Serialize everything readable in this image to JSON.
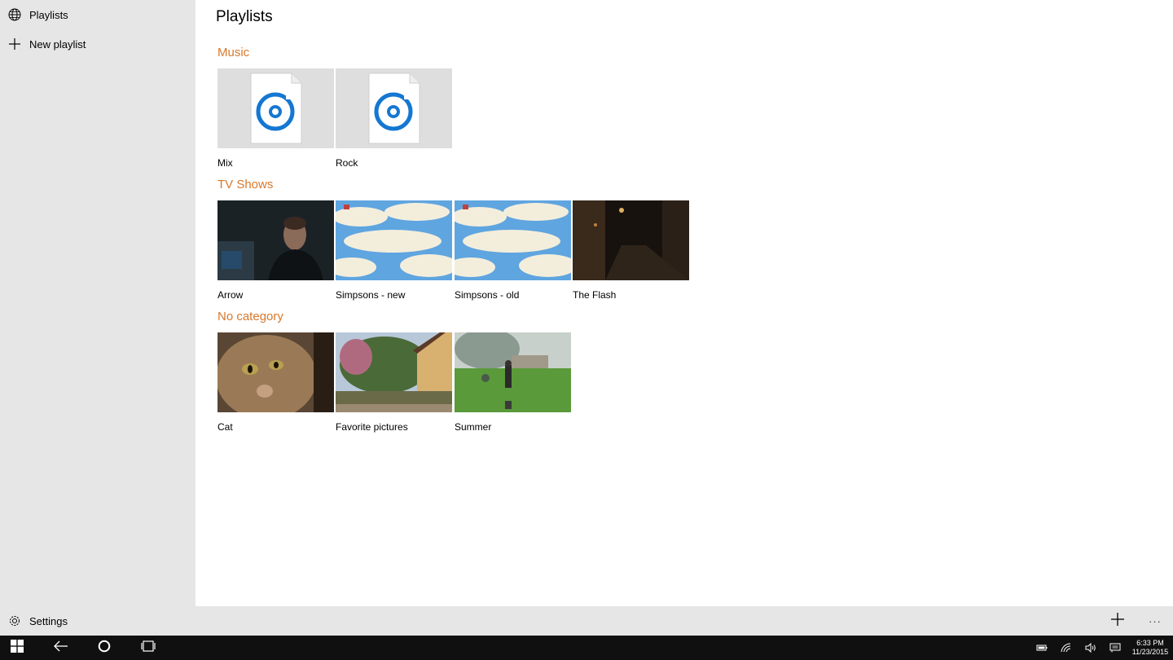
{
  "sidebar": {
    "items": [
      {
        "label": "Playlists",
        "icon": "globe-icon"
      },
      {
        "label": "New playlist",
        "icon": "plus-icon"
      }
    ],
    "settings_label": "Settings"
  },
  "main": {
    "title": "Playlists",
    "sections": [
      {
        "title": "Music",
        "items": [
          "Mix",
          "Rock"
        ]
      },
      {
        "title": "TV Shows",
        "items": [
          "Arrow",
          "Simpsons - new",
          "Simpsons - old",
          "The Flash"
        ]
      },
      {
        "title": "No category",
        "items": [
          "Cat",
          "Favorite pictures",
          "Summer"
        ]
      }
    ]
  },
  "appbar": {
    "more_label": "···"
  },
  "taskbar": {
    "time": "6:33 PM",
    "date": "11/23/2015"
  },
  "colors": {
    "accent": "#d9782b",
    "music_icon": "#1477d2",
    "sidebar_bg": "#e6e6e6",
    "taskbar_bg": "#101010"
  }
}
